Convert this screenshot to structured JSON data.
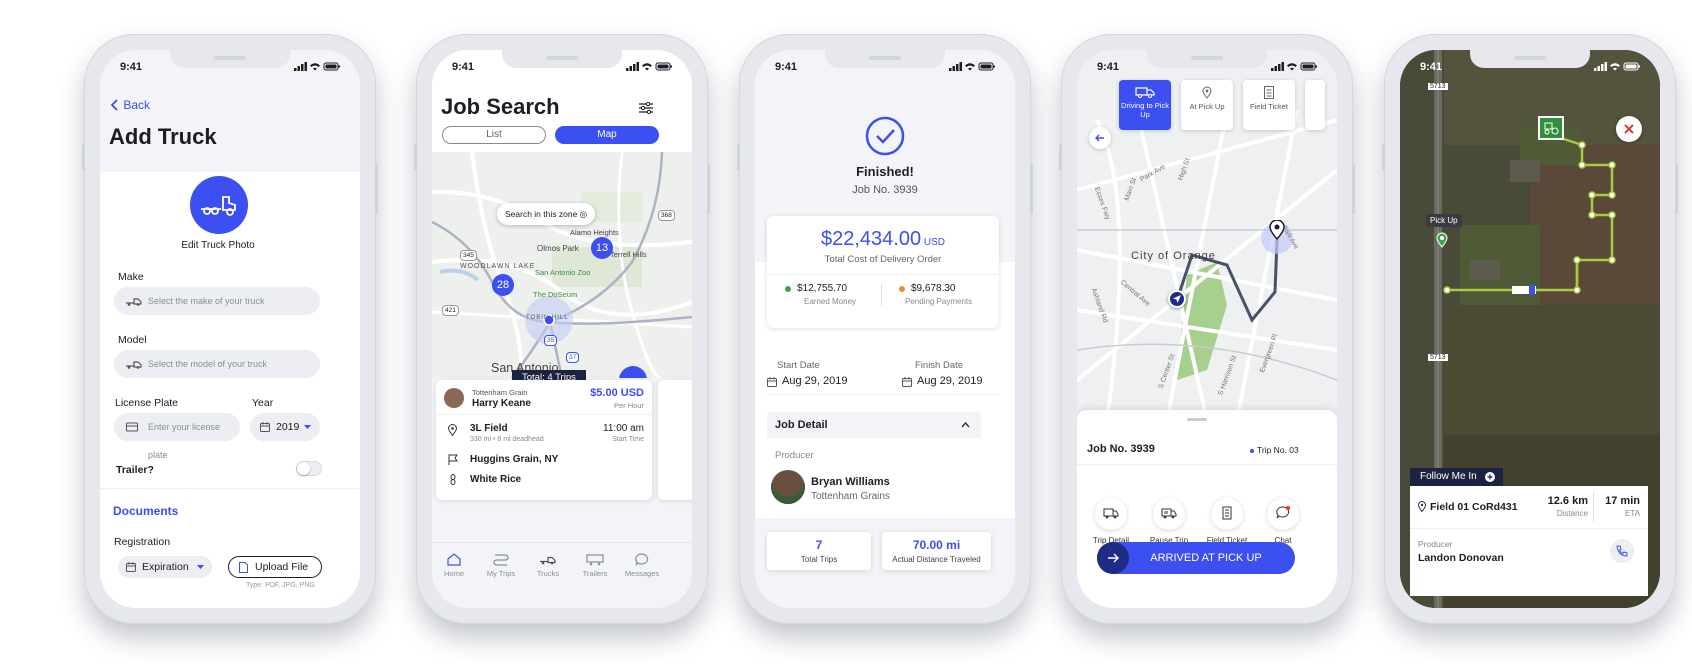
{
  "status": {
    "time": "9:41"
  },
  "add_truck": {
    "back": "Back",
    "title": "Add Truck",
    "photo_label": "Edit Truck Photo",
    "make_label": "Make",
    "make_placeholder": "Select the make of your truck",
    "model_label": "Model",
    "model_placeholder": "Select the model of your truck",
    "plate_label": "License Plate",
    "plate_placeholder": "Enter your license plate",
    "year_label": "Year",
    "year_value": "2019",
    "trailer_label": "Trailer?",
    "documents": "Documents",
    "registration": "Registration",
    "expiration": "Expiration",
    "upload": "Upload File",
    "file_types": "Type: PDF, JPG, PNG"
  },
  "job_search": {
    "title": "Job Search",
    "seg_list": "List",
    "seg_map": "Map",
    "search_zone": "Search in this zone",
    "map_labels": [
      "Alamo Heights",
      "Olmos Park",
      "Terrell Hills",
      "San Antonio Zoo",
      "The DoSeum",
      "WOODLAWN LAKE",
      "TOBIN HILL",
      "San Antonio"
    ],
    "road_numbers": [
      "368",
      "345",
      "421",
      "35",
      "37"
    ],
    "cluster_28": "28",
    "cluster_13": "13",
    "total": "Total: 4 Trips",
    "company": "Tottenham Grain",
    "driver": "Harry Keane",
    "price": "$5.00 USD",
    "price_unit": "Per Hour",
    "field": "3L Field",
    "field_sub": "330 mi • 8 mi deadhead",
    "start": "11:00 am",
    "start_label": "Start Time",
    "dest": "Huggins Grain, NY",
    "crop": "White Rice",
    "tabs": [
      "Home",
      "My Trips",
      "Trucks",
      "Trailers",
      "Messages"
    ]
  },
  "finished": {
    "title": "Finished!",
    "job": "Job No. 3939",
    "amount": "$22,434.00",
    "currency": "USD",
    "amount_label": "Total Cost of Delivery Order",
    "earned": "$12,755.70",
    "earned_label": "Earned Money",
    "pending": "$9,678.30",
    "pending_label": "Pending Payments",
    "start_label": "Start Date",
    "start": "Aug 29, 2019",
    "finish_label": "Finish Date",
    "finish": "Aug 29, 2019",
    "job_detail": "Job Detail",
    "producer_label": "Producer",
    "producer": "Bryan Williams",
    "producer_company": "Tottenham Grains",
    "trips": "7",
    "trips_label": "Total Trips",
    "distance": "70.00 mi",
    "distance_label": "Actual Distance Traveled"
  },
  "trip": {
    "steps": [
      {
        "label": "Driving to Pick Up"
      },
      {
        "label": "At Pick Up"
      },
      {
        "label": "Field Ticket"
      }
    ],
    "map_labels": [
      "City of Orange",
      "Park Ave",
      "Main St",
      "High St",
      "Essex Fwy",
      "Central Ave",
      "Ashland Rd",
      "Evergreen Pl",
      "S Center St",
      "S Harrison St",
      "Hickory St",
      "Lincoln St",
      "Cleveland St",
      "Park Ave"
    ],
    "job": "Job No. 3939",
    "trip_no": "Trip No. 03",
    "actions": [
      "Trip Detail",
      "Pause Trip",
      "Field Ticket",
      "Chat"
    ],
    "arrived": "ARRIVED AT PICK UP"
  },
  "field_map": {
    "road1": "5713",
    "road2": "5713",
    "pickup": "Pick Up",
    "follow": "Follow Me In",
    "field": "Field 01 CoRd431",
    "distance": "12.6 km",
    "distance_label": "Distance",
    "eta": "17 min",
    "eta_label": "ETA",
    "producer_label": "Producer",
    "producer": "Landon Donovan"
  },
  "colors": {
    "accent": "#3c4ff0",
    "accent_dark": "#1f2c86",
    "green": "#3fa34d",
    "route": "#a8cc3e",
    "orange": "#f08a2b",
    "red": "#e53935"
  }
}
